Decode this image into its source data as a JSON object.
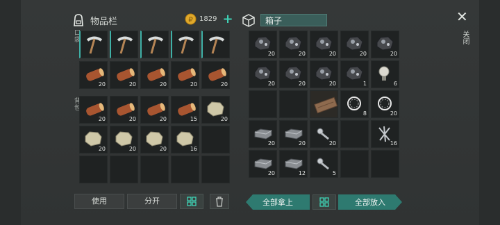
{
  "inventory": {
    "title": "物品栏",
    "hotbar_label": "口袋",
    "backpack_label": "背包",
    "currency": {
      "amount": "1829",
      "add": "+"
    },
    "hotbar": [
      {
        "item": "pickaxe",
        "qty": ""
      },
      {
        "item": "pickaxe",
        "qty": ""
      },
      {
        "item": "pickaxe",
        "qty": ""
      },
      {
        "item": "pickaxe",
        "qty": ""
      },
      {
        "item": "pickaxe",
        "qty": ""
      }
    ],
    "hotbar_row2": [
      {
        "item": "log",
        "qty": "20"
      },
      {
        "item": "log",
        "qty": "20"
      },
      {
        "item": "log",
        "qty": "20"
      },
      {
        "item": "log",
        "qty": "20"
      },
      {
        "item": "log",
        "qty": "20"
      }
    ],
    "backpack": [
      {
        "item": "log",
        "qty": "20"
      },
      {
        "item": "log",
        "qty": "20"
      },
      {
        "item": "log",
        "qty": "20"
      },
      {
        "item": "log",
        "qty": "15"
      },
      {
        "item": "stone",
        "qty": "20"
      },
      {
        "item": "stone",
        "qty": "20"
      },
      {
        "item": "stone",
        "qty": "20"
      },
      {
        "item": "stone",
        "qty": "20"
      },
      {
        "item": "stone",
        "qty": "16"
      },
      {
        "item": "",
        "qty": ""
      },
      {
        "item": "",
        "qty": ""
      },
      {
        "item": "",
        "qty": ""
      },
      {
        "item": "",
        "qty": ""
      },
      {
        "item": "",
        "qty": ""
      },
      {
        "item": "",
        "qty": ""
      }
    ],
    "buttons": {
      "use": "使用",
      "split": "分开"
    }
  },
  "box": {
    "title": "箱子",
    "slots": [
      {
        "item": "ore",
        "qty": "20"
      },
      {
        "item": "ore",
        "qty": "20"
      },
      {
        "item": "ore",
        "qty": "20"
      },
      {
        "item": "ore",
        "qty": "20"
      },
      {
        "item": "ore",
        "qty": "20"
      },
      {
        "item": "ore",
        "qty": "20"
      },
      {
        "item": "ore",
        "qty": "20"
      },
      {
        "item": "ore",
        "qty": "20"
      },
      {
        "item": "ore",
        "qty": "1"
      },
      {
        "item": "bulb",
        "qty": "6"
      },
      {
        "item": "",
        "qty": ""
      },
      {
        "item": "",
        "qty": ""
      },
      {
        "item": "plank",
        "qty": ""
      },
      {
        "item": "ring",
        "qty": "8"
      },
      {
        "item": "ring",
        "qty": "20"
      },
      {
        "item": "ingot",
        "qty": "20"
      },
      {
        "item": "ingot",
        "qty": "20"
      },
      {
        "item": "bolt",
        "qty": "20"
      },
      {
        "item": "",
        "qty": ""
      },
      {
        "item": "nails",
        "qty": "16"
      },
      {
        "item": "ingot",
        "qty": "20"
      },
      {
        "item": "ingot",
        "qty": "12"
      },
      {
        "item": "bolt",
        "qty": "5"
      },
      {
        "item": "",
        "qty": ""
      },
      {
        "item": "",
        "qty": ""
      }
    ],
    "buttons": {
      "take_all": "全部拿上",
      "put_all": "全部放入"
    }
  },
  "close_label": "关闭"
}
